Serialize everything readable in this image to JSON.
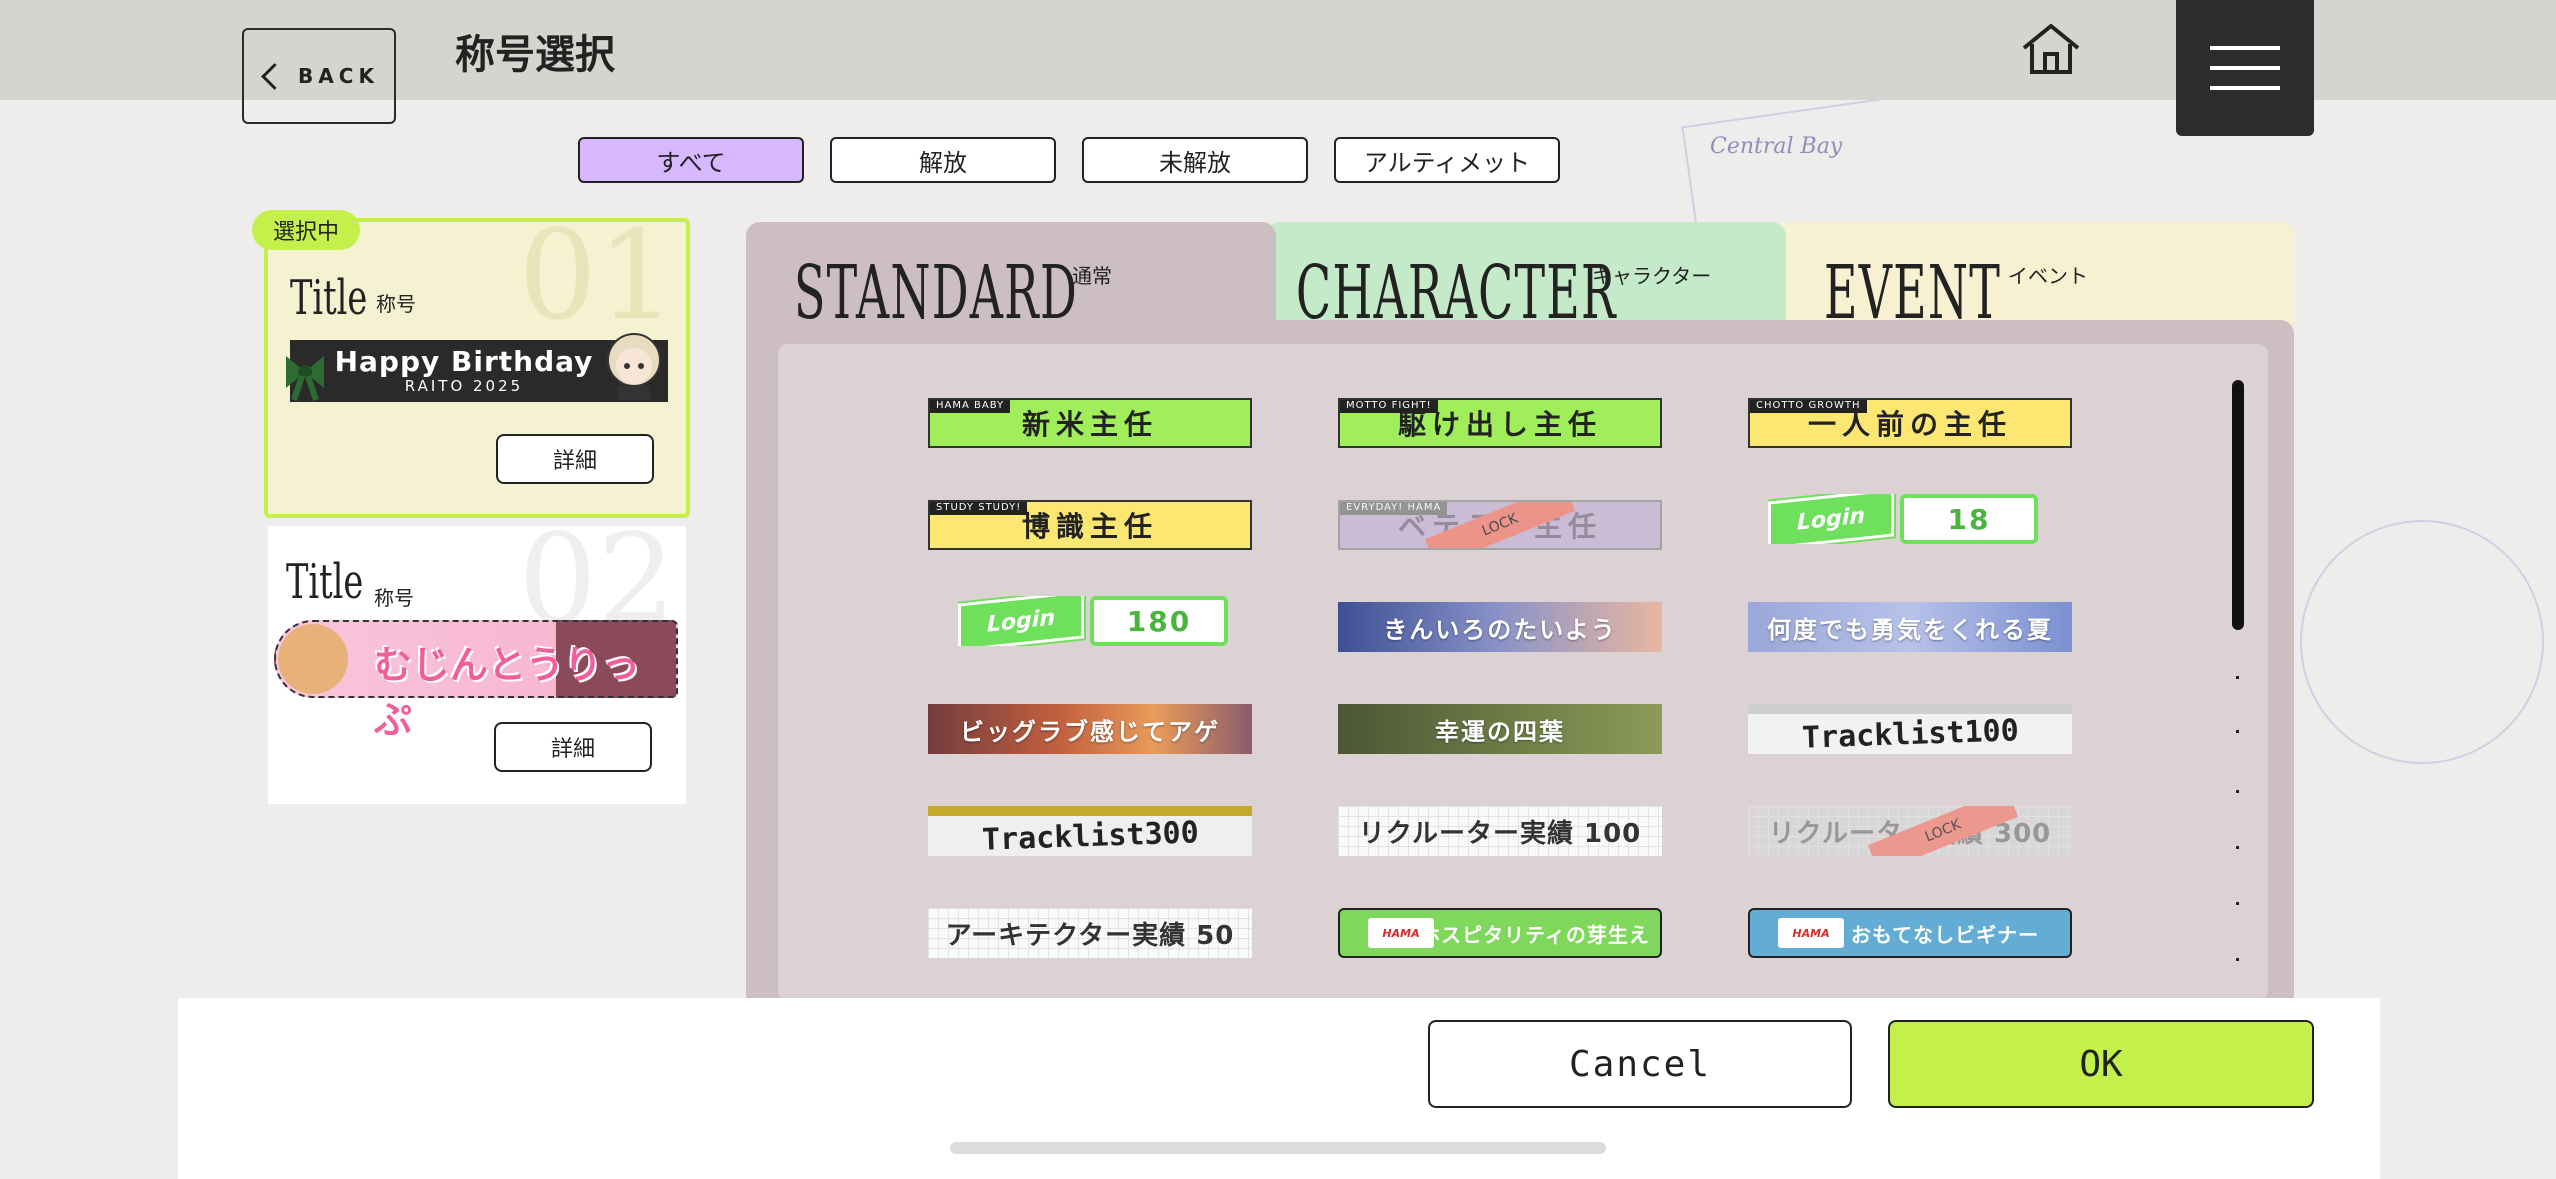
{
  "header": {
    "back_label": "BACK",
    "title": "称号選択"
  },
  "filters": [
    {
      "label": "すべて",
      "active": true
    },
    {
      "label": "解放",
      "active": false
    },
    {
      "label": "未解放",
      "active": false
    },
    {
      "label": "アルティメット",
      "active": false
    }
  ],
  "background_text": "Central Bay",
  "slots": [
    {
      "badge": "選択中",
      "number": "01",
      "title": "Title",
      "title_sub": "称号",
      "plate_main": "Happy Birthday",
      "plate_sub": "RAITO 2025",
      "detail_label": "詳細"
    },
    {
      "number": "02",
      "title": "Title",
      "title_sub": "称号",
      "plate_main": "むじんとうりっぷ",
      "detail_label": "詳細"
    }
  ],
  "tabs": [
    {
      "label": "STANDARD",
      "sub": "通常"
    },
    {
      "label": "CHARACTER",
      "sub": "キャラクター"
    },
    {
      "label": "EVENT",
      "sub": "イベント"
    }
  ],
  "titles": [
    {
      "tag": "HAMA BABY",
      "text": "新米主任",
      "style": "green"
    },
    {
      "tag": "MOTTO FIGHT!",
      "text": "駆け出し主任",
      "style": "green"
    },
    {
      "tag": "CHOTTO GROWTH",
      "text": "一人前の主任",
      "style": "yellow"
    },
    {
      "tag": "STUDY STUDY!",
      "text": "博識主任",
      "style": "yellow"
    },
    {
      "tag": "EVRYDAY! HAMA",
      "text": "ベテラン主任",
      "style": "locked",
      "lock": "LOCK"
    },
    {
      "login": "Login",
      "count": "18",
      "style": "login"
    },
    {
      "login": "Login",
      "count": "180",
      "style": "login"
    },
    {
      "text": "きんいろのたいよう",
      "style": "photo1"
    },
    {
      "text": "何度でも勇気をくれる夏",
      "style": "photo2"
    },
    {
      "text": "ビッグラブ感じてアゲ",
      "style": "photo3"
    },
    {
      "text": "幸運の四葉",
      "style": "photo4"
    },
    {
      "text": "Tracklist100",
      "style": "tracklist gray"
    },
    {
      "text": "Tracklist300",
      "style": "tracklist"
    },
    {
      "text": "リクルーター実績 100",
      "style": "grid-paper"
    },
    {
      "text": "リクルーター実績 300",
      "style": "grid-paper locked-gray",
      "lock": "LOCK"
    },
    {
      "text": "アーキテクター実績 50",
      "style": "grid-paper"
    },
    {
      "logo": "HAMA",
      "text": "ホスピタリティの芽生え",
      "style": "hama g"
    },
    {
      "logo": "HAMA",
      "text": "おもてなしビギナー",
      "style": "hama b"
    }
  ],
  "footer": {
    "cancel_label": "Cancel",
    "ok_label": "OK"
  },
  "colors": {
    "accent_green": "#c3f04b",
    "filter_active": "#d7b7fd",
    "topbar": "#d5d5cf"
  }
}
